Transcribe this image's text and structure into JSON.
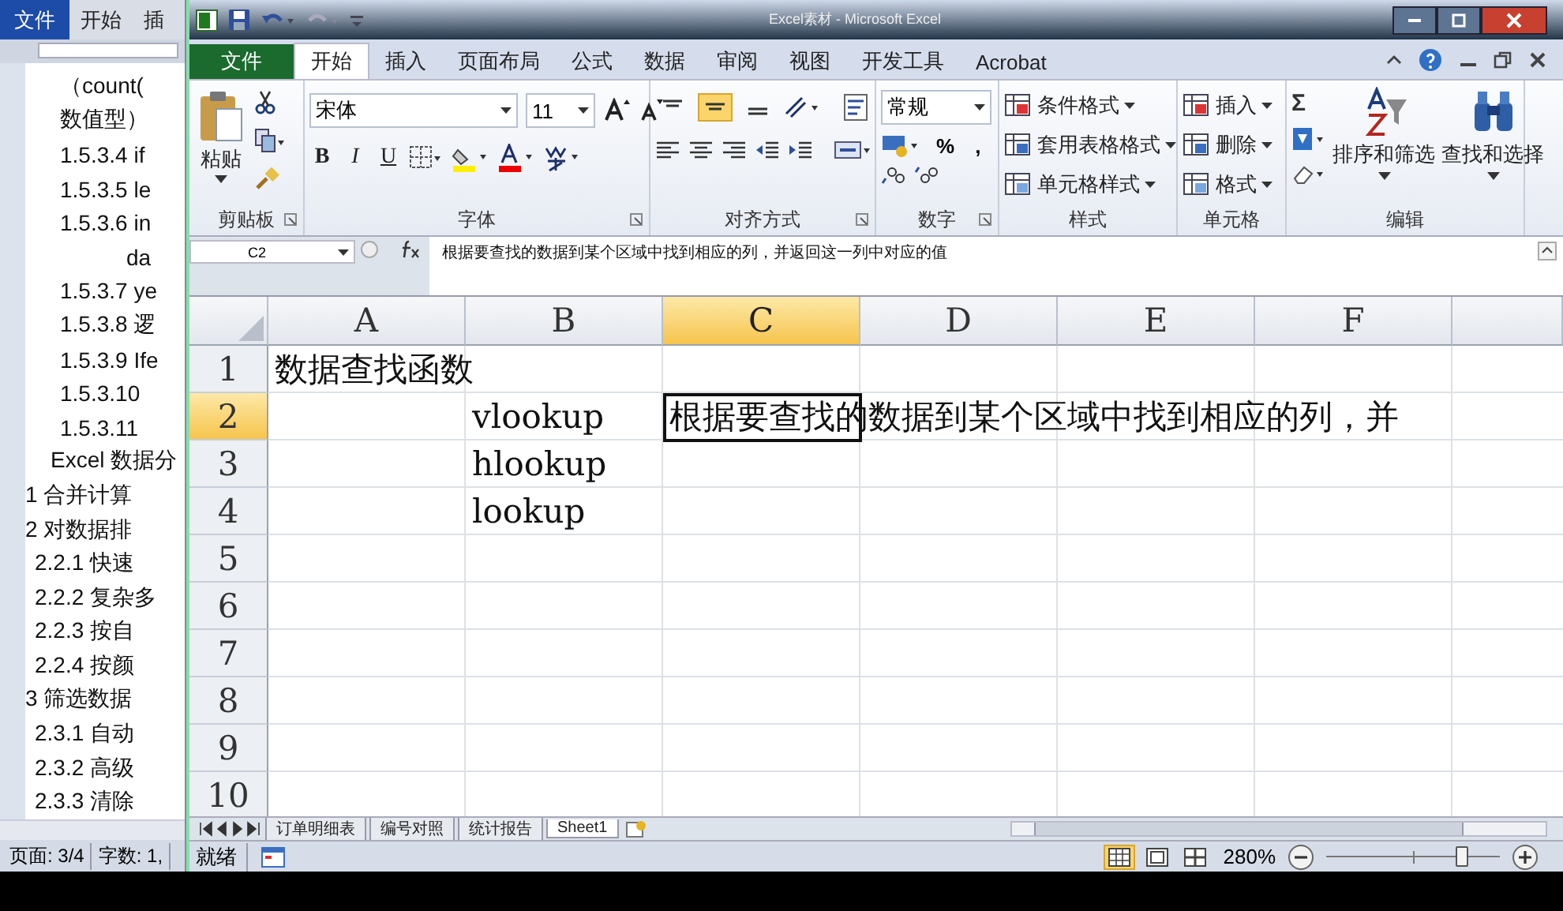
{
  "word": {
    "tabs": [
      {
        "label": "文件",
        "selected": true
      },
      {
        "label": "开始",
        "selected": false
      },
      {
        "label": "插",
        "selected": false
      }
    ],
    "lines": [
      {
        "kind": "l3",
        "text": "（count("
      },
      {
        "kind": "l3",
        "text": "数值型）"
      },
      {
        "kind": "l3",
        "text": "1.5.3.4 if"
      },
      {
        "kind": "l3",
        "text": "1.5.3.5 le"
      },
      {
        "kind": "l3",
        "text": "1.5.3.6 in"
      },
      {
        "kind": "cont",
        "text": "da"
      },
      {
        "kind": "l3",
        "text": "1.5.3.7 ye"
      },
      {
        "kind": "l3",
        "text": "1.5.3.8 逻"
      },
      {
        "kind": "l3",
        "text": "1.5.3.9 Ife"
      },
      {
        "kind": "l3",
        "text": "1.5.3.10"
      },
      {
        "kind": "l3",
        "text": "1.5.3.11"
      },
      {
        "kind": "l1",
        "text": "Excel 数据分"
      },
      {
        "kind": "num",
        "text": "1  合并计算"
      },
      {
        "kind": "num",
        "text": "2  对数据排"
      },
      {
        "kind": "l2",
        "text": "2.2.1 快速"
      },
      {
        "kind": "l2",
        "text": "2.2.2 复杂多"
      },
      {
        "kind": "l2",
        "text": "2.2.3 按自"
      },
      {
        "kind": "l2",
        "text": "2.2.4 按颜"
      },
      {
        "kind": "num",
        "text": "3  筛选数据"
      },
      {
        "kind": "l2",
        "text": "2.3.1 自动"
      },
      {
        "kind": "l2",
        "text": "2.3.2 高级"
      },
      {
        "kind": "l2",
        "text": "2.3.3 清除"
      }
    ],
    "status": [
      "页面: 3/4",
      "字数: 1,"
    ]
  },
  "excel": {
    "title": "Excel素材 - Microsoft Excel",
    "tabs": [
      {
        "label": "文件",
        "kind": "file",
        "selected": false
      },
      {
        "label": "开始",
        "kind": "tab",
        "selected": true
      },
      {
        "label": "插入",
        "kind": "tab",
        "selected": false
      },
      {
        "label": "页面布局",
        "kind": "tab",
        "selected": false
      },
      {
        "label": "公式",
        "kind": "tab",
        "selected": false
      },
      {
        "label": "数据",
        "kind": "tab",
        "selected": false
      },
      {
        "label": "审阅",
        "kind": "tab",
        "selected": false
      },
      {
        "label": "视图",
        "kind": "tab",
        "selected": false
      },
      {
        "label": "开发工具",
        "kind": "tab",
        "selected": false
      },
      {
        "label": "Acrobat",
        "kind": "tab",
        "selected": false
      }
    ],
    "ribbon": {
      "groups": [
        {
          "kind": "clipboard",
          "label": "剪贴板",
          "paste": "粘贴"
        },
        {
          "kind": "font",
          "label": "字体",
          "font_name": "宋体",
          "font_size": "11",
          "style_buttons": [
            "B",
            "I",
            "U"
          ]
        },
        {
          "kind": "alignment",
          "label": "对齐方式",
          "align_buttons": [
            {
              "selected": false
            },
            {
              "selected": true
            },
            {
              "selected": false
            }
          ]
        },
        {
          "kind": "number",
          "label": "数字",
          "format": "常规",
          "symbols": [
            "%",
            ","
          ]
        },
        {
          "kind": "styles",
          "label": "样式",
          "items": [
            "条件格式",
            "套用表格格式",
            "单元格样式"
          ]
        },
        {
          "kind": "cells",
          "label": "单元格",
          "items": [
            "插入",
            "删除",
            "格式"
          ]
        },
        {
          "kind": "editing",
          "label": "编辑",
          "sum": "Σ",
          "items": [
            "排序和筛选",
            "查找和选择"
          ]
        }
      ]
    },
    "name_box": "C2",
    "formula": "根据要查找的数据到某个区域中找到相应的列，并返回这一列中对应的值",
    "columns": [
      {
        "label": "A",
        "selected": false
      },
      {
        "label": "B",
        "selected": false
      },
      {
        "label": "C",
        "selected": true
      },
      {
        "label": "D",
        "selected": false
      },
      {
        "label": "E",
        "selected": false
      },
      {
        "label": "F",
        "selected": false
      }
    ],
    "rows": [
      {
        "label": "1",
        "selected": false,
        "cells": [
          {
            "text": "数据查找函数",
            "selected": false
          }
        ]
      },
      {
        "label": "2",
        "selected": true,
        "cells": [
          null,
          {
            "text": "vlookup",
            "selected": false
          },
          {
            "text": "根据要查找的数据到某个区域中找到相应的列，并",
            "selected": true
          }
        ]
      },
      {
        "label": "3",
        "selected": false,
        "cells": [
          null,
          {
            "text": "hlookup",
            "selected": false
          }
        ]
      },
      {
        "label": "4",
        "selected": false,
        "cells": [
          null,
          {
            "text": "lookup",
            "selected": false
          }
        ]
      },
      {
        "label": "5",
        "selected": false
      },
      {
        "label": "6",
        "selected": false
      },
      {
        "label": "7",
        "selected": false
      },
      {
        "label": "8",
        "selected": false
      },
      {
        "label": "9",
        "selected": false
      },
      {
        "label": "10",
        "selected": false
      }
    ],
    "sheets": [
      {
        "label": "订单明细表",
        "selected": false
      },
      {
        "label": "编号对照",
        "selected": false
      },
      {
        "label": "统计报告",
        "selected": false
      },
      {
        "label": "Sheet1",
        "selected": true
      }
    ],
    "status": "就绪",
    "views": [
      {
        "kind": "normal",
        "selected": true
      },
      {
        "kind": "layout",
        "selected": false
      },
      {
        "kind": "pagebreak",
        "selected": false
      }
    ],
    "zoom": {
      "reading": "280%",
      "level": 0.78
    }
  }
}
